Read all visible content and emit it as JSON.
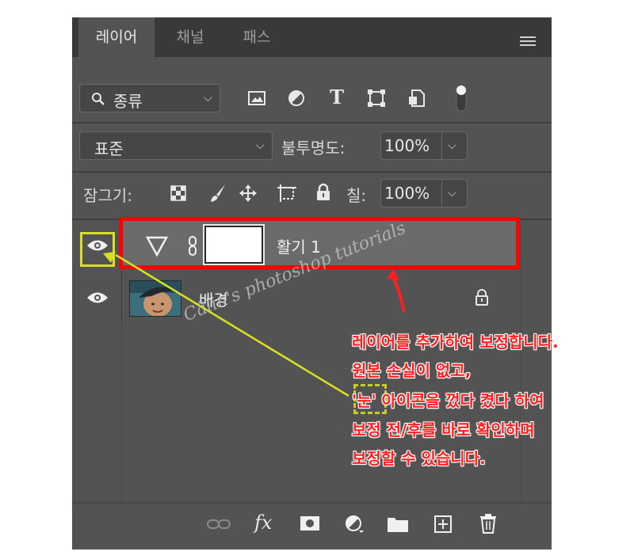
{
  "tabs": [
    {
      "label": "레이어"
    },
    {
      "label": "채널"
    },
    {
      "label": "패스"
    }
  ],
  "filter": {
    "kind_label": "종류",
    "icons": [
      "image-filter-icon",
      "adjustment-filter-icon",
      "type-filter-icon",
      "shape-filter-icon",
      "smart-object-filter-icon",
      "filter-toggle-icon"
    ]
  },
  "blend": {
    "mode": "표준",
    "opacity_label": "불투명도:",
    "opacity_value": "100%"
  },
  "lock": {
    "label": "잠그기:",
    "fill_label": "칠:",
    "fill_value": "100%"
  },
  "layers": [
    {
      "name": "활기 1",
      "visible": true,
      "selected": true,
      "type": "vibrance-adjustment"
    },
    {
      "name": "배경",
      "visible": true,
      "locked": true,
      "type": "background-image"
    }
  ],
  "footer_icons": [
    "link-layers-icon",
    "fx-icon",
    "add-mask-icon",
    "new-adjustment-icon",
    "new-group-icon",
    "new-layer-icon",
    "delete-layer-icon"
  ],
  "footer_fx_label": "fx",
  "annotation": {
    "lines": [
      "레이어를 추가하여 보정합니다.",
      "원본 손실이 없고,",
      "'눈' 아이콘을 껐다 켰다 하여",
      "보정 전/후를 바로 확인하며",
      "보정할 수 있습니다."
    ],
    "highlight_color": "#ff0000",
    "arrow_color": "#d8e020"
  },
  "watermark": "Câlin's photoshop tutorials",
  "colors": {
    "panel_bg": "#535353",
    "tabbar_bg": "#393939",
    "field_bg": "#464646",
    "selected_layer_bg": "#6b6b6b"
  }
}
